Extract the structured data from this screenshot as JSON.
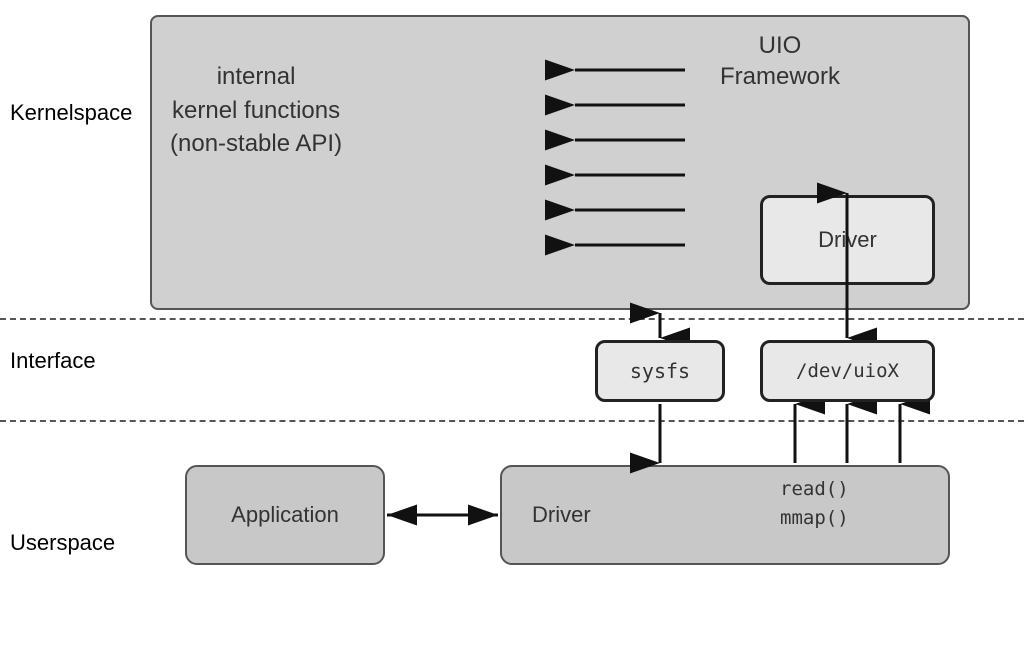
{
  "zones": {
    "kernelspace_label": "Kernelspace",
    "interface_label": "Interface",
    "userspace_label": "Userspace"
  },
  "boxes": {
    "kernel_functions_line1": "internal",
    "kernel_functions_line2": "kernel functions",
    "kernel_functions_line3": "(non-stable API)",
    "uio_framework_line1": "UIO",
    "uio_framework_line2": "Framework",
    "driver_kernel": "Driver",
    "sysfs": "sysfs",
    "devuiox": "/dev/uioX",
    "application": "Application",
    "driver_user": "Driver",
    "read_call": "read()",
    "mmap_call": "mmap()"
  },
  "colors": {
    "background": "#ffffff",
    "kernel_box_fill": "#d0d0d0",
    "uio_area_fill": "#b0b0b0",
    "driver_box_fill": "#e8e8e8",
    "userspace_box_fill": "#c8c8c8",
    "border_dark": "#222222",
    "border_medium": "#555555",
    "text_dark": "#333333"
  }
}
